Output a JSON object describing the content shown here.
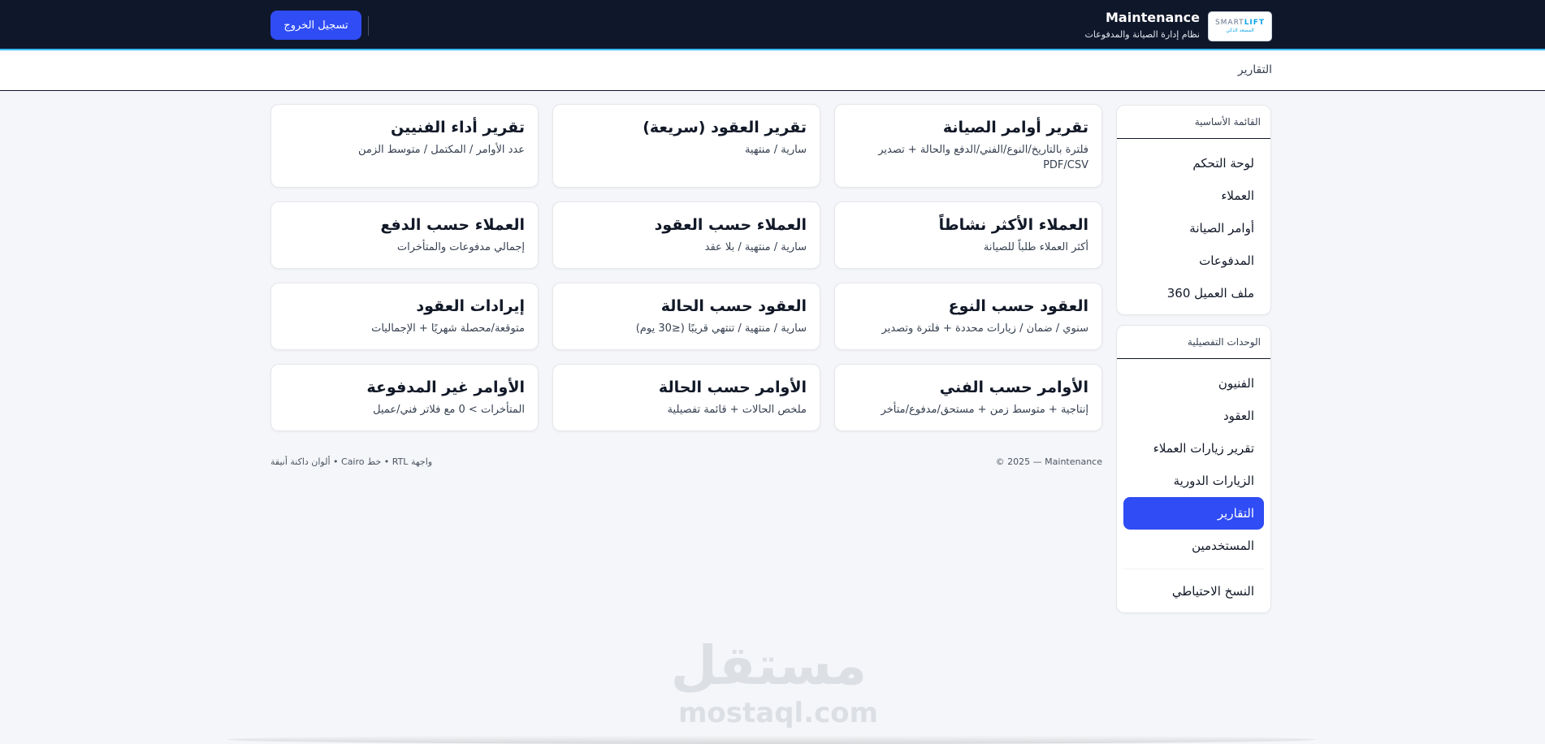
{
  "header": {
    "logo_line1_a": "SMART",
    "logo_line1_b": "LIFT",
    "logo_line2": "المصعد الذكي",
    "title": "Maintenance",
    "subtitle": "نظام إدارة الصيانة والمدفوعات",
    "logout_label": "تسجيل الخروج"
  },
  "breadcrumb": {
    "current": "التقارير"
  },
  "sidebar": {
    "main_heading": "القائمة الأساسية",
    "main_items": [
      {
        "label": "لوحة التحكم"
      },
      {
        "label": "العملاء"
      },
      {
        "label": "أوامر الصيانة"
      },
      {
        "label": "المدفوعات"
      },
      {
        "label": "ملف العميل 360"
      }
    ],
    "detail_heading": "الوحدات التفصيلية",
    "detail_items": [
      {
        "label": "الفنيون"
      },
      {
        "label": "العقود"
      },
      {
        "label": "تقرير زيارات العملاء"
      },
      {
        "label": "الزيارات الدورية"
      },
      {
        "label": "التقارير",
        "active": true
      },
      {
        "label": "المستخدمين"
      },
      {
        "label": "النسخ الاحتياطي"
      }
    ]
  },
  "reports": [
    {
      "title": "تقرير أوامر الصيانة",
      "desc": "فلترة بالتاريخ/النوع/الفني/الدفع والحالة + تصدير PDF/CSV"
    },
    {
      "title": "تقرير العقود (سريعة)",
      "desc": "سارية / منتهية"
    },
    {
      "title": "تقرير أداء الفنيين",
      "desc": "عدد الأوامر / المكتمل / متوسط الزمن"
    },
    {
      "title": "العملاء الأكثر نشاطاً",
      "desc": "أكثر العملاء طلباً للصيانة"
    },
    {
      "title": "العملاء حسب العقود",
      "desc": "سارية / منتهية / بلا عقد"
    },
    {
      "title": "العملاء حسب الدفع",
      "desc": "إجمالي مدفوعات والمتأخرات"
    },
    {
      "title": "العقود حسب النوع",
      "desc": "سنوي / ضمان / زيارات محددة + فلترة وتصدير"
    },
    {
      "title": "العقود حسب الحالة",
      "desc": "سارية / منتهية / تنتهي قريبًا (≤30 يوم)"
    },
    {
      "title": "إيرادات العقود",
      "desc": "متوقعة/محصلة شهريًا + الإجماليات"
    },
    {
      "title": "الأوامر حسب الفني",
      "desc": "إنتاجية + متوسط زمن + مستحق/مدفوع/متأخر"
    },
    {
      "title": "الأوامر حسب الحالة",
      "desc": "ملخص الحالات + قائمة تفصيلية"
    },
    {
      "title": "الأوامر غير المدفوعة",
      "desc": "المتأخرات > 0 مع فلاتر فني/عميل"
    }
  ],
  "footer": {
    "copyright": "© 2025 — Maintenance",
    "note": "واجهة RTL • خط Cairo • ألوان داكنة أنيقة"
  },
  "watermark": {
    "arabic": "مستقل",
    "latin": "mostaql.com"
  }
}
